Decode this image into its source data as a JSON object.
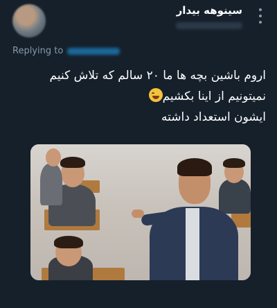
{
  "tweet": {
    "author": {
      "display_name": "سینوهه بیدار"
    },
    "replying_label": "Replying to",
    "body_lines": [
      "اروم باشین بچه ها ما ۲۰ سالم که تلاش کنیم",
      "نمیتونیم از اینا بکشیم",
      "ایشون استعداد داشته"
    ],
    "emoji": "grinning-sweat-face"
  },
  "icons": {
    "more": "more-vertical-icon"
  }
}
